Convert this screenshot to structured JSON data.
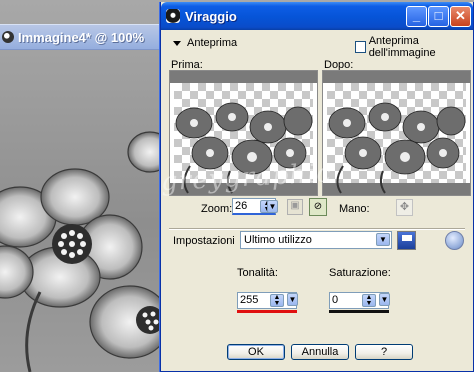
{
  "background_window": {
    "title": "Immagine4* @  100%"
  },
  "dialog": {
    "title": "Viraggio",
    "preview_toggle_label": "Anteprima",
    "image_preview_label": "Anteprima dell'immagine",
    "before_label": "Prima:",
    "after_label": "Dopo:",
    "watermark": "greygraphic",
    "zoom_label": "Zoom:",
    "zoom_value": "26",
    "hand_label": "Mano:",
    "settings_label": "Impostazioni",
    "settings_value": "Ultimo utilizzo",
    "hue_label": "Tonalità:",
    "hue_value": "255",
    "saturation_label": "Saturazione:",
    "saturation_value": "0",
    "ok_label": "OK",
    "cancel_label": "Annulla",
    "help_label": "?"
  },
  "colors": {
    "titlebar": "#0654d7",
    "dialog_bg": "#ece9d8",
    "hue_bar": "#e01010",
    "saturation_bar": "#111111"
  }
}
